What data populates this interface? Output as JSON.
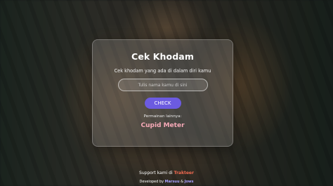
{
  "card": {
    "title": "Cek Khodam",
    "subtitle": "Cek khodam yang ada di dalam diri kamu",
    "input_placeholder": "Tulis nama kamu di sini",
    "input_value": "",
    "check_label": "CHECK",
    "other_games_label": "Permainan lainnya:",
    "cupid_meter_label": "Cupid Meter"
  },
  "footer": {
    "support_prefix": "Support kami di ",
    "support_link": "Trakteer",
    "dev_prefix": "Developed by ",
    "dev_name_1": "Marsuu",
    "dev_amp": " & ",
    "dev_name_2": "Jows"
  },
  "colors": {
    "button": "#6c5be0",
    "cupid_link": "#f6a9b7",
    "trakteer": "#f06a50",
    "dev_names": "#a9a0ff"
  },
  "background": "blurred-tiger-photo"
}
